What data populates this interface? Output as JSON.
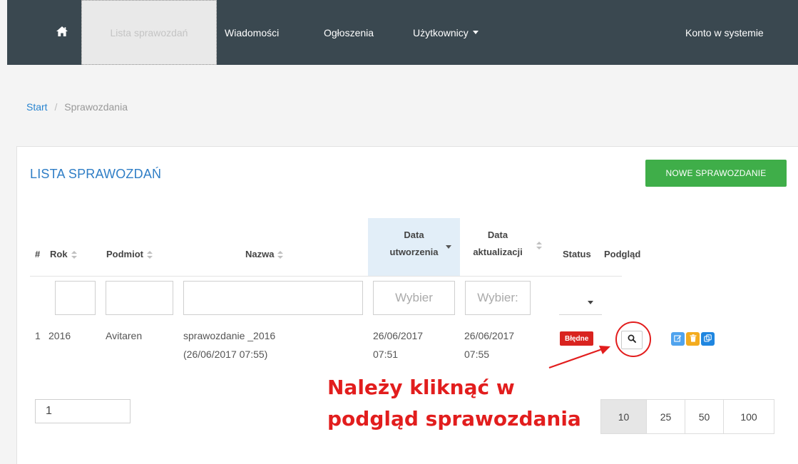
{
  "navbar": {
    "home_icon": "home-icon",
    "items": [
      {
        "label": "Lista sprawozdań",
        "active": true
      },
      {
        "label": "Wiadomości"
      },
      {
        "label": "Ogłoszenia"
      },
      {
        "label": "Użytkownicy"
      }
    ],
    "account": "Konto w systemie",
    "bg_color": "#3a4850"
  },
  "breadcrumb": {
    "start": "Start",
    "separator": "/",
    "current": "Sprawozdania"
  },
  "panel": {
    "title": "LISTA SPRAWOZDAŃ",
    "new_button": "NOWE SPRAWOZDANIE",
    "new_button_color": "#3fae49"
  },
  "table": {
    "headers": {
      "num": "#",
      "rok": "Rok",
      "podmiot": "Podmiot",
      "nazwa": "Nazwa",
      "data_utworzenia_1": "Data",
      "data_utworzenia_2": "utworzenia",
      "data_aktualizacji_1": "Data",
      "data_aktualizacji_2": "aktualizacji",
      "status": "Status",
      "podglad": "Podgląd"
    },
    "filters": {
      "rok": "",
      "podmiot": "",
      "nazwa": "",
      "data_utworzenia_placeholder": "Wybier",
      "data_aktualizacji_placeholder": "Wybier:",
      "status": ""
    },
    "rows": [
      {
        "num": "1",
        "rok": "2016",
        "podmiot": "Avitaren",
        "nazwa_line1": "sprawozdanie _2016",
        "nazwa_line2": "(26/06/2017 07:55)",
        "utw_date": "26/06/2017",
        "utw_time": "07:51",
        "akt_date": "26/06/2017",
        "akt_time": "07:55",
        "status": "Błędne",
        "status_color": "#d9231f",
        "actions": [
          "search-icon",
          "edit-icon",
          "delete-icon",
          "copy-icon"
        ]
      }
    ]
  },
  "pagination": {
    "page_value": "1",
    "sizes": [
      "10",
      "25",
      "50",
      "100"
    ],
    "active_size": "10"
  },
  "annotation": {
    "line1": "Należy kliknąć w",
    "line2": "podgląd sprawozdania",
    "color": "#e21d1d"
  }
}
